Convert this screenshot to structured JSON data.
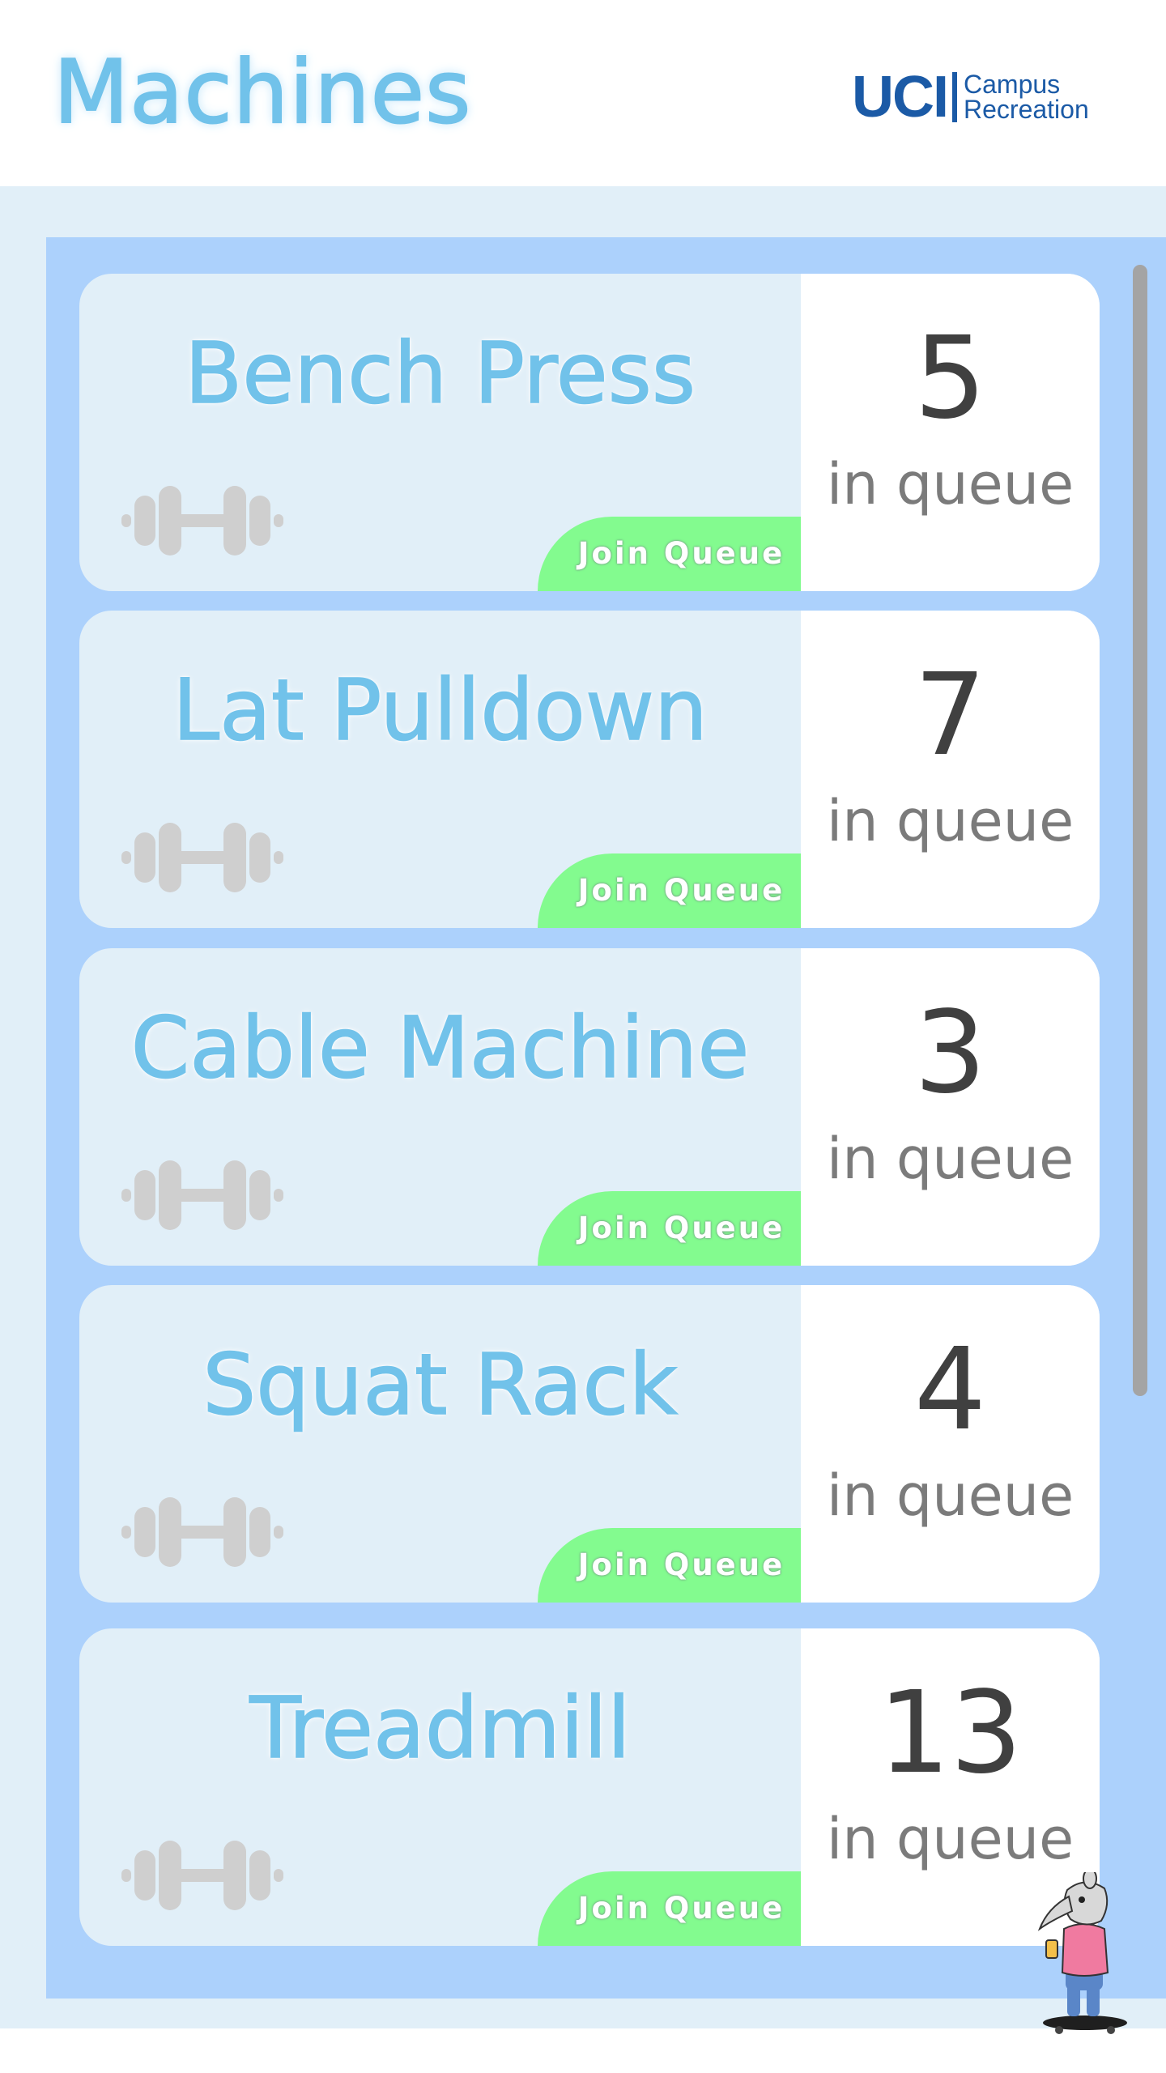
{
  "header": {
    "title": "Machines",
    "brand": {
      "mark": "UCI",
      "line1": "Campus",
      "line2": "Recreation",
      "color": "#1b5aa6"
    }
  },
  "machines": [
    {
      "name": "Bench Press",
      "count": "5",
      "queue_label": "in queue",
      "button_label": "Join Queue",
      "icon": "dumbbell-icon"
    },
    {
      "name": "Lat Pulldown",
      "count": "7",
      "queue_label": "in queue",
      "button_label": "Join Queue",
      "icon": "dumbbell-icon"
    },
    {
      "name": "Cable Machine",
      "count": "3",
      "queue_label": "in queue",
      "button_label": "Join Queue",
      "icon": "dumbbell-icon"
    },
    {
      "name": "Squat Rack",
      "count": "4",
      "queue_label": "in queue",
      "button_label": "Join Queue",
      "icon": "dumbbell-icon"
    },
    {
      "name": "Treadmill",
      "count": "13",
      "queue_label": "in queue",
      "button_label": "Join Queue",
      "icon": "dumbbell-icon"
    }
  ],
  "colors": {
    "title": "#71c2ea",
    "panel": "#acd1fc",
    "card": "#e1eff8",
    "join_button": "#83fb8f",
    "count_text": "#404040",
    "queue_text": "#7b7b7b"
  }
}
